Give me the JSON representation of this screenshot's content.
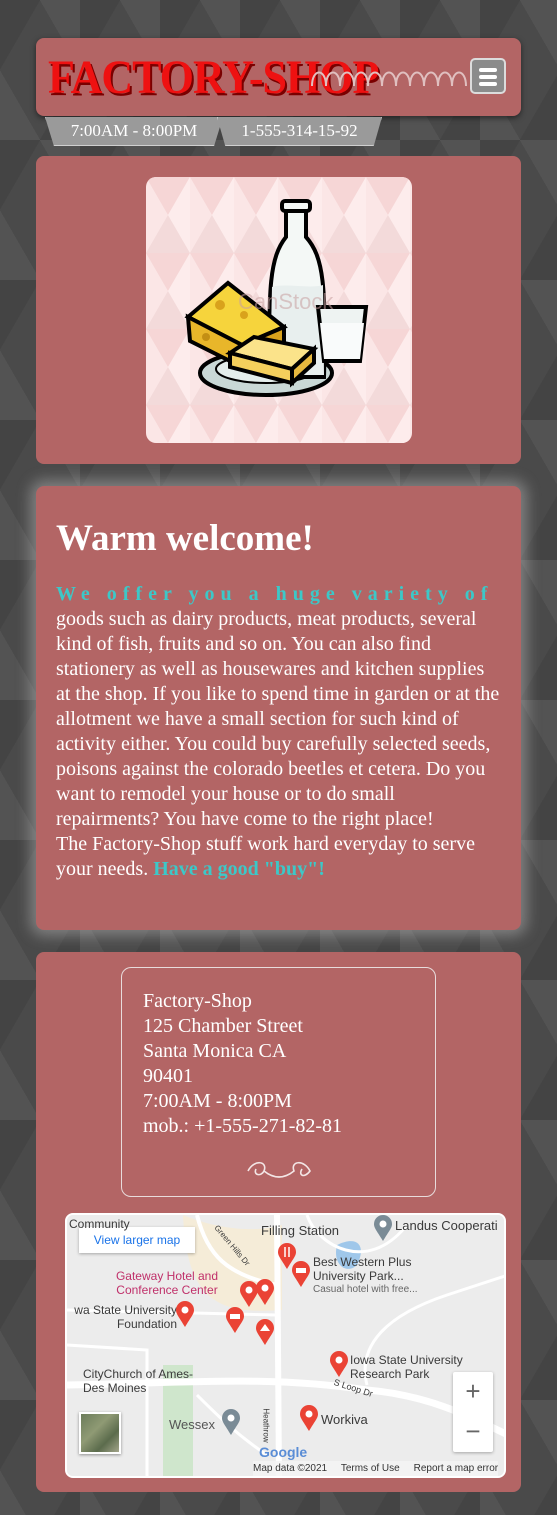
{
  "header": {
    "logo": "FACTORY-SHOP",
    "hours": "7:00AM - 8:00PM",
    "phone": "1-555-314-15-92"
  },
  "welcome": {
    "title": "Warm welcome!",
    "intro": "We offer you a huge variety of",
    "body": "goods such as dairy products, meat products, several kind of fish, fruits and so on. You can also find stationery as well as housewares and kitchen supplies at the shop. If you like to spend time in garden or at the allotment we have a small section for such kind of activity either. You could buy carefully selected seeds, poisons against the colorado beetles et cetera. Do you want to remodel your house or to do small repairments? You have come to the right place!",
    "closing_text": "The Factory-Shop stuff work hard everyday to serve your needs.",
    "closing_highlight": "Have a good \"buy\"!"
  },
  "food_image": {
    "watermark": "CanStock"
  },
  "address": {
    "name": "Factory-Shop",
    "street": "125 Chamber Street",
    "city": "Santa Monica CA",
    "zip": "90401",
    "hours": "7:00AM - 8:00PM",
    "mobile": "mob.: +1-555-271-82-81"
  },
  "map": {
    "view_larger": "View larger map",
    "labels": {
      "community": "Community",
      "filling_station": "Filling Station",
      "landus": "Landus Cooperati",
      "green_hills": "Green Hills Dr",
      "gateway": "Gateway Hotel and Conference Center",
      "best_western": "Best Western Plus University Park...",
      "best_western_sub": "Casual hotel with free...",
      "isu_foundation": "wa State University Foundation",
      "isu_research": "Iowa State University Research Park",
      "citychurch": "CityChurch of Ames-Des Moines",
      "s_loop": "S Loop Dr",
      "wessex": "Wessex",
      "heathrow": "Heathrow",
      "workiva": "Workiva",
      "google": "Google"
    },
    "zoom_in": "+",
    "zoom_out": "−",
    "attribution": [
      "Map data ©2021",
      "Terms of Use",
      "Report a map error"
    ]
  },
  "colors": {
    "card": "#b36565",
    "accent": "#3cc8c8",
    "logo": "#ee1111"
  },
  "icons": [
    "hamburger-menu-icon",
    "coil-decoration-icon",
    "flourish-icon",
    "map-pin-icon",
    "hotel-pin-icon",
    "restaurant-pin-icon",
    "museum-pin-icon"
  ]
}
